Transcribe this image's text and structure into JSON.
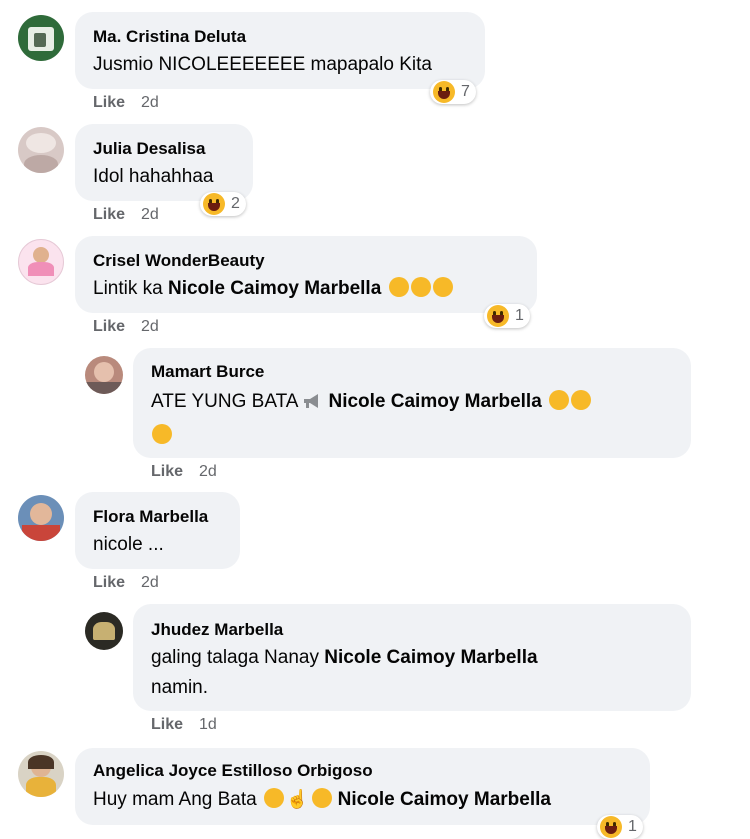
{
  "comments": [
    {
      "name": "Ma. Cristina Deluta",
      "text": "Jusmio NICOLEEEEEEE mapapalo Kita",
      "like": "Like",
      "time": "2d",
      "reaction_count": "7"
    },
    {
      "name": "Julia Desalisa",
      "text": "Idol hahahhaa",
      "like": "Like",
      "time": "2d",
      "reaction_count": "2"
    },
    {
      "name": "Crisel WonderBeauty",
      "text_prefix": "Lintik ka ",
      "mention": "Nicole Caimoy Marbella",
      "like": "Like",
      "time": "2d",
      "reaction_count": "1"
    },
    {
      "name": "Mamart Burce",
      "text_prefix": "ATE YUNG BATA",
      "mention": "Nicole Caimoy Marbella",
      "like": "Like",
      "time": "2d"
    },
    {
      "name": "Flora Marbella",
      "text": "nicole ...",
      "like": "Like",
      "time": "2d"
    },
    {
      "name": "Jhudez Marbella",
      "text_prefix": "galing talaga Nanay ",
      "mention": "Nicole Caimoy Marbella",
      "text_suffix": "namin.",
      "like": "Like",
      "time": "1d"
    },
    {
      "name": "Angelica Joyce Estilloso Orbigoso",
      "text_prefix": "Huy mam Ang Bata ",
      "mention": "Nicole Caimoy Marbella",
      "reaction_count": "1"
    }
  ],
  "colors": {
    "bubble": "#f0f2f5",
    "meta": "#65676b",
    "emoji": "#f7b928"
  }
}
